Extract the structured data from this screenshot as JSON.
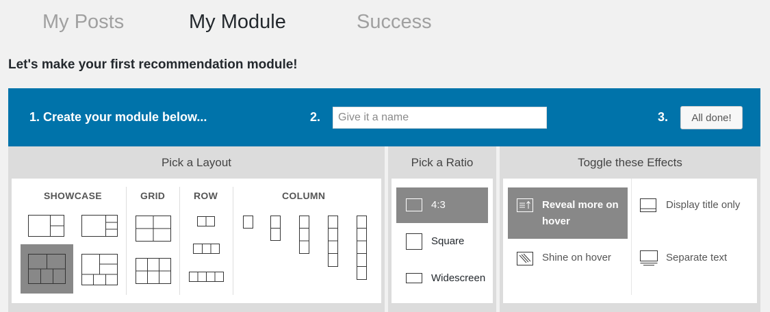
{
  "tabs": [
    {
      "label": "My Posts",
      "state": "inactive"
    },
    {
      "label": "My Module",
      "state": "active"
    },
    {
      "label": "Success",
      "state": "inactive"
    }
  ],
  "intro": "Let's make your first recommendation module!",
  "steps": {
    "step1": "1. Create your module below...",
    "step2_number": "2.",
    "name_placeholder": "Give it a name",
    "name_value": "",
    "step3_number": "3.",
    "done_label": "All done!"
  },
  "layout_panel": {
    "title": "Pick a Layout",
    "groups": [
      "SHOWCASE",
      "GRID",
      "ROW",
      "COLUMN"
    ],
    "selected": "showcase-3"
  },
  "ratio_panel": {
    "title": "Pick a Ratio",
    "options": [
      "4:3",
      "Square",
      "Widescreen"
    ],
    "selected": "4:3"
  },
  "effects_panel": {
    "title": "Toggle these Effects",
    "options": [
      {
        "label": "Reveal more on hover",
        "icon": "reveal-icon",
        "selected": true
      },
      {
        "label": "Display title only",
        "icon": "title-only-icon",
        "selected": false
      },
      {
        "label": "Shine on hover",
        "icon": "shine-icon",
        "selected": false
      },
      {
        "label": "Separate text",
        "icon": "separate-text-icon",
        "selected": false
      }
    ]
  },
  "colors": {
    "accent": "#0073aa",
    "selected_bg": "#888888",
    "panel_bg": "#dcdcdc",
    "page_bg": "#f1f1f1"
  }
}
